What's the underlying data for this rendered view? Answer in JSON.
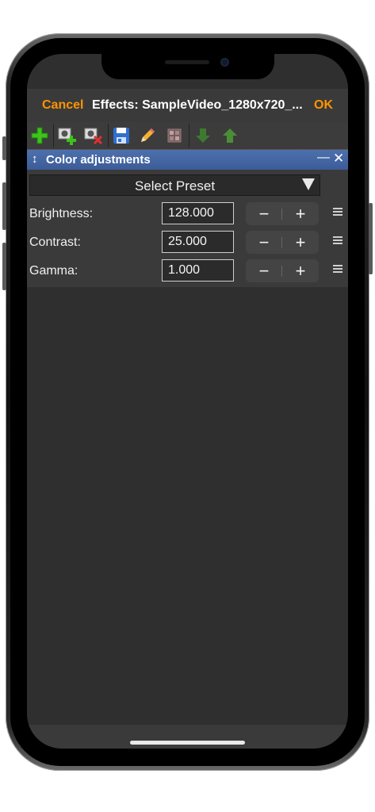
{
  "navbar": {
    "cancel_label": "Cancel",
    "title": "Effects: SampleVideo_1280x720_...",
    "ok_label": "OK"
  },
  "toolbar": {
    "icons": [
      "add-effect-icon",
      "add-preset-icon",
      "delete-preset-icon",
      "save-icon",
      "edit-pencil-icon",
      "grid-icon",
      "move-down-icon",
      "move-up-icon"
    ]
  },
  "panel": {
    "title": "Color adjustments",
    "minimize_label": "—",
    "close_label": "✕",
    "resize_glyph": "↕"
  },
  "preset": {
    "label": "Select Preset"
  },
  "rows": [
    {
      "label": "Brightness:",
      "value": "128.000",
      "minus": "−",
      "plus": "+"
    },
    {
      "label": "Contrast:",
      "value": "25.000",
      "minus": "−",
      "plus": "+"
    },
    {
      "label": "Gamma:",
      "value": "1.000",
      "minus": "−",
      "plus": "+"
    }
  ],
  "colors": {
    "accent": "#ff9500",
    "panel_header": "#3b5c98",
    "background": "#2f2f2f"
  }
}
